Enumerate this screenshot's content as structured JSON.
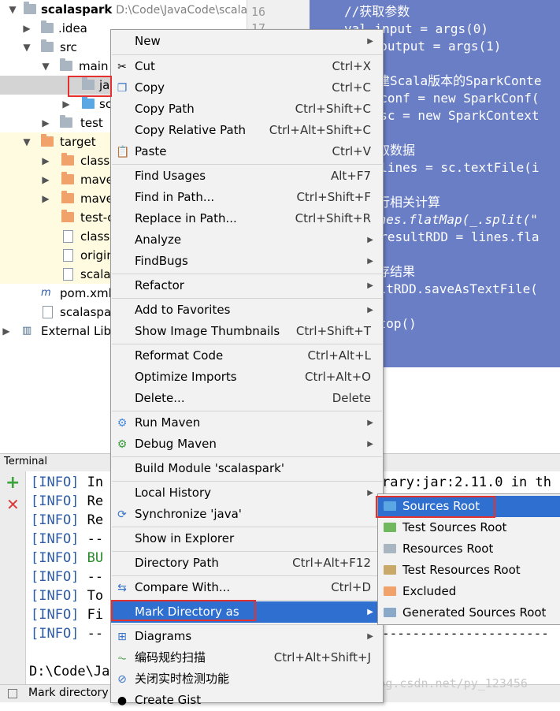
{
  "project_tree": {
    "root": {
      "name": "scalaspark",
      "path": "D:\\Code\\JavaCode\\scala"
    },
    "items": [
      {
        "label": "idea_label",
        "text": ".idea"
      },
      {
        "text": "src"
      },
      {
        "text": "main"
      },
      {
        "text": "java"
      },
      {
        "text": "scala"
      },
      {
        "text": "test"
      },
      {
        "text": "target"
      },
      {
        "text": "classes"
      },
      {
        "text": "maven-archiver"
      },
      {
        "text": "maven-status"
      },
      {
        "text": "test-classes"
      },
      {
        "text": "classes"
      },
      {
        "text": "original-"
      },
      {
        "text": "scala-"
      },
      {
        "text": "pom.xml"
      },
      {
        "text": "scalaspark"
      },
      {
        "text": "External Libr"
      }
    ]
  },
  "editor": {
    "line_numbers": [
      "16",
      "17"
    ],
    "lines": [
      "//获取参数",
      "val input = args(0)",
      "  output = args(1)",
      "",
      "建Scala版本的SparkConte",
      "  conf = new SparkConf(",
      "  sc = new SparkContext",
      "",
      "取数据",
      "  lines = sc.textFile(i",
      "",
      "行相关计算",
      " nes.flatMap(_.split(\"",
      "  resultRDD = lines.fla",
      "",
      "存结果",
      " ltRDD.saveAsTextFile(",
      "",
      " top()"
    ]
  },
  "context_menu": {
    "items": [
      {
        "label": "New",
        "shortcut": "",
        "submenu": true
      },
      {
        "label": "Cut",
        "shortcut": "Ctrl+X",
        "icon": "scissors-icon"
      },
      {
        "label": "Copy",
        "shortcut": "Ctrl+C",
        "icon": "copy-icon"
      },
      {
        "label": "Copy Path",
        "shortcut": "Ctrl+Shift+C"
      },
      {
        "label": "Copy Relative Path",
        "shortcut": "Ctrl+Alt+Shift+C"
      },
      {
        "label": "Paste",
        "shortcut": "Ctrl+V",
        "icon": "paste-icon"
      },
      {
        "label": "Find Usages",
        "shortcut": "Alt+F7"
      },
      {
        "label": "Find in Path...",
        "shortcut": "Ctrl+Shift+F"
      },
      {
        "label": "Replace in Path...",
        "shortcut": "Ctrl+Shift+R"
      },
      {
        "label": "Analyze",
        "shortcut": "",
        "submenu": true
      },
      {
        "label": "FindBugs",
        "shortcut": "",
        "submenu": true
      },
      {
        "label": "Refactor",
        "shortcut": "",
        "submenu": true
      },
      {
        "label": "Add to Favorites",
        "shortcut": "",
        "submenu": true
      },
      {
        "label": "Show Image Thumbnails",
        "shortcut": "Ctrl+Shift+T"
      },
      {
        "label": "Reformat Code",
        "shortcut": "Ctrl+Alt+L"
      },
      {
        "label": "Optimize Imports",
        "shortcut": "Ctrl+Alt+O"
      },
      {
        "label": "Delete...",
        "shortcut": "Delete"
      },
      {
        "label": "Run Maven",
        "shortcut": "",
        "submenu": true,
        "icon": "gear-icon"
      },
      {
        "label": "Debug Maven",
        "shortcut": "",
        "submenu": true,
        "icon": "gear-icon"
      },
      {
        "label": "Build Module 'scalaspark'",
        "shortcut": ""
      },
      {
        "label": "Local History",
        "shortcut": "",
        "submenu": true
      },
      {
        "label": "Synchronize 'java'",
        "shortcut": "",
        "icon": "sync-icon"
      },
      {
        "label": "Show in Explorer",
        "shortcut": ""
      },
      {
        "label": "Directory Path",
        "shortcut": "Ctrl+Alt+F12"
      },
      {
        "label": "Compare With...",
        "shortcut": "Ctrl+D",
        "icon": "compare-icon"
      },
      {
        "label": "Mark Directory as",
        "shortcut": "",
        "submenu": true,
        "active": true
      },
      {
        "label": "Diagrams",
        "shortcut": "",
        "submenu": true,
        "icon": "diagram-icon"
      },
      {
        "label": "编码规约扫描",
        "shortcut": "Ctrl+Alt+Shift+J",
        "icon": "scan-icon"
      },
      {
        "label": "关闭实时检测功能",
        "shortcut": "",
        "icon": "block-icon"
      },
      {
        "label": "Create Gist",
        "shortcut": "",
        "icon": "github-icon"
      }
    ]
  },
  "submenu": {
    "items": [
      {
        "label": "Sources Root",
        "color": "#5ba7e4",
        "active": true
      },
      {
        "label": "Test Sources Root",
        "color": "#70b85d"
      },
      {
        "label": "Resources Root",
        "color": "#a9b6c2"
      },
      {
        "label": "Test Resources Root",
        "color": "#c9a96a"
      },
      {
        "label": "Excluded",
        "color": "#f0a26a"
      },
      {
        "label": "Generated Sources Root",
        "color": "#8aa9c8"
      }
    ]
  },
  "terminal": {
    "title": "Terminal",
    "lines": [
      {
        "level": "[INFO]",
        "text": " In"
      },
      {
        "level": "[INFO]",
        "text": " Re"
      },
      {
        "level": "[INFO]",
        "text": " Re"
      },
      {
        "level": "[INFO]",
        "text": " --"
      },
      {
        "level": "[INFO]",
        "text": " BU"
      },
      {
        "level": "[INFO]",
        "text": " --"
      },
      {
        "level": "[INFO]",
        "text": " To"
      },
      {
        "level": "[INFO]",
        "text": " Fi"
      },
      {
        "level": "[INFO]",
        "text": " --"
      }
    ],
    "right_line": "rary:jar:2.11.0 in th",
    "dash_line": "----------------------",
    "prompt": "D:\\Code\\Ja"
  },
  "status_bar": {
    "text": "Mark directory"
  },
  "watermark": "https://blog.csdn.net/py_123456",
  "colors": {
    "accent": "#2e6fd0",
    "editor_bg": "#6a7ec6",
    "highlight_box": "#e53030"
  }
}
